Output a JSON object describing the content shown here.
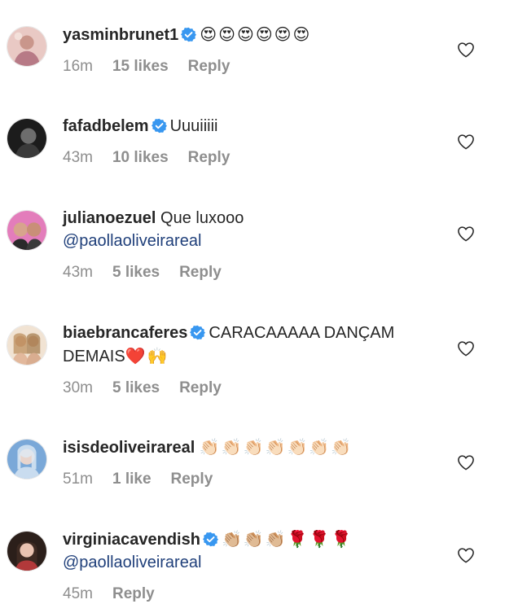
{
  "comments": [
    {
      "username": "yasminbrunet1",
      "verified": true,
      "text": "",
      "emoji": "😍😍😍😍😍😍",
      "mention": "",
      "time": "16m",
      "likes": "15 likes",
      "reply": "Reply"
    },
    {
      "username": "fafadbelem",
      "verified": true,
      "text": "Uuuiiiii",
      "emoji": "",
      "mention": "",
      "time": "43m",
      "likes": "10 likes",
      "reply": "Reply"
    },
    {
      "username": "julianoezuel",
      "verified": false,
      "text": "Que luxooo",
      "emoji": "",
      "mention": "@paollaoliveirareal",
      "time": "43m",
      "likes": "5 likes",
      "reply": "Reply"
    },
    {
      "username": "biaebrancaferes",
      "verified": true,
      "text": "CARACAAAAA DANÇAM DEMAIS",
      "emoji": "❤️🙌",
      "mention": "",
      "time": "30m",
      "likes": "5 likes",
      "reply": "Reply"
    },
    {
      "username": "isisdeoliveirareal",
      "verified": false,
      "text": "",
      "emoji": "👏🏻👏🏻👏🏻👏🏻👏🏻👏🏻👏🏻",
      "mention": "",
      "time": "51m",
      "likes": "1 like",
      "reply": "Reply"
    },
    {
      "username": "virginiacavendish",
      "verified": true,
      "text": "",
      "emoji": "👏🏼👏🏼👏🏼🌹🌹🌹",
      "mention": "@paollaoliveirareal",
      "time": "45m",
      "likes": "",
      "reply": "Reply"
    }
  ],
  "colors": {
    "verified": "#3897f0",
    "mention": "#1f3f7a",
    "meta": "#8e8e8e",
    "text": "#262626"
  },
  "icons": {
    "verified": "verified-badge-icon",
    "like": "heart-outline-icon"
  }
}
